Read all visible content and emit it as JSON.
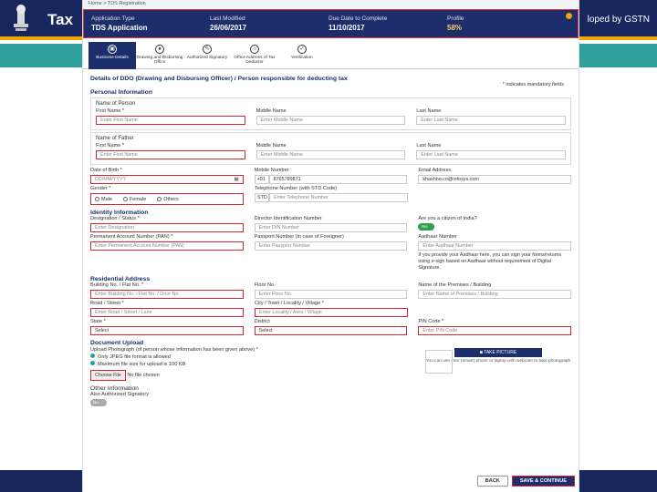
{
  "slide": {
    "title": "Tax",
    "developed_by": "loped by GSTN"
  },
  "breadcrumb": "Home > TDS Registration",
  "summary": {
    "application_type_label": "Application Type",
    "application_type_value": "TDS Application",
    "last_modified_label": "Last Modified",
    "last_modified_value": "26/06/2017",
    "due_date_label": "Due Date to Complete",
    "due_date_value": "11/10/2017",
    "profile_label": "Profile",
    "profile_value": "58%"
  },
  "steps": [
    "Business Details",
    "Drawing and Disbursing Office",
    "Authorized Signatory",
    "Office Address of Tax Deductor",
    "Verification"
  ],
  "form": {
    "heading": "Details of DDO (Drawing and Disbursing Officer) / Person responsible for deducting tax",
    "mandatory_note": "* indicates mandatory fields",
    "personal_info_title": "Personal Information",
    "name_of_person": "Name of Person",
    "first_name_label": "First Name *",
    "first_name_ph": "Enter First Name",
    "middle_name_label": "Middle Name",
    "middle_name_ph": "Enter Middle Name",
    "last_name_label": "Last Name",
    "last_name_ph": "Enter Last Name",
    "name_of_father": "Name of Father",
    "father_first_label": "First Name *",
    "father_first_ph": "Enter First Name",
    "father_middle_label": "Middle Name",
    "father_middle_ph": "Enter Middle Name",
    "father_last_label": "Last Name",
    "father_last_ph": "Enter Last Name",
    "dob_label": "Date of Birth *",
    "dob_ph": "DD/MM/YYYY",
    "mobile_label": "Mobile Number",
    "mobile_prefix": "+91",
    "mobile_value": "8765789871",
    "email_label": "Email Address",
    "email_value": "khashbo.co@infosys.com",
    "gender_label": "Gender *",
    "gender_options": [
      "Male",
      "Female",
      "Others"
    ],
    "telephone_label": "Telephone Number (with STD Code)",
    "std_ph": "STD",
    "telephone_ph": "Enter Telephone Number",
    "identity_title": "Identity Information",
    "designation_label": "Designation / Status *",
    "designation_ph": "Enter Designation",
    "din_label": "Director Identification Number",
    "din_ph": "Enter DIN Number",
    "citizen_label": "Are you a citizen of India?",
    "citizen_toggle": "Yes",
    "pan_label": "Permanent Account Number (PAN) *",
    "pan_ph": "Enter Permanent Account Number (PAN)",
    "passport_label": "Passport Number (in case of Foreigner)",
    "passport_ph": "Enter Passport Number",
    "aadhaar_label": "Aadhaar Number",
    "aadhaar_ph": "Enter Aadhaar Number",
    "aadhaar_info": "If you provide your Aadhaar here, you can sign your forms/returns using e-sign based on Aadhaar without requirement of Digital Signature.",
    "residential_title": "Residential Address",
    "building_label": "Building No. / Flat No. *",
    "building_ph": "Enter Building No. / Flat No. / Door No.",
    "floor_label": "Floor No.",
    "floor_ph": "Enter Floor No.",
    "premises_label": "Name of the Premises / Building",
    "premises_ph": "Enter Name of Premises / Building",
    "road_label": "Road / Street *",
    "road_ph": "Enter Road / Street / Lane",
    "city_label": "City / Town / Locality / Village *",
    "city_ph": "Enter Locality / Area / Village",
    "district_label": "District",
    "district_value": "Select",
    "state_label": "State *",
    "state_value": "Select",
    "pin_label": "PIN Code *",
    "pin_ph": "Enter PIN Code",
    "document_title": "Document Upload",
    "upload_instruction": "Upload Photograph (of person whose information has been given above) *",
    "upload_rule1": "Only JPEG file format is allowed",
    "upload_rule2": "Maximum file size for upload is 100 KB",
    "choose_file": "Choose File",
    "no_file": "No file chosen",
    "take_picture": "TAKE PICTURE",
    "take_picture_note": "You can use your (smart) phone or laptop with webcam to take photograph",
    "other_info_title": "Other Information",
    "also_signatory_label": "Also Authorized Signatory",
    "also_signatory_toggle": "No",
    "back_button": "BACK",
    "save_button": "SAVE & CONTINUE"
  }
}
